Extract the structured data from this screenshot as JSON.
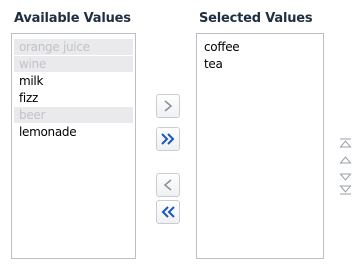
{
  "headers": {
    "available": "Available Values",
    "selected": "Selected Values"
  },
  "available_items": [
    {
      "label": "orange juice",
      "state": "disabled"
    },
    {
      "label": "wine",
      "state": "disabled"
    },
    {
      "label": "milk",
      "state": "enabled"
    },
    {
      "label": "fizz",
      "state": "enabled"
    },
    {
      "label": "beer",
      "state": "disabled"
    },
    {
      "label": "lemonade",
      "state": "enabled"
    }
  ],
  "selected_items": [
    {
      "label": "coffee"
    },
    {
      "label": "tea"
    }
  ],
  "shuttle_buttons": [
    {
      "name": "move-right-button",
      "icon": "chevron-right-icon",
      "enabled": false
    },
    {
      "name": "move-all-right-button",
      "icon": "double-chevron-right-icon",
      "enabled": true
    },
    {
      "name": "move-left-button",
      "icon": "chevron-left-icon",
      "enabled": false
    },
    {
      "name": "move-all-left-button",
      "icon": "double-chevron-left-icon",
      "enabled": true
    }
  ],
  "order_buttons": [
    {
      "name": "move-top-button",
      "icon": "move-top-icon"
    },
    {
      "name": "move-up-button",
      "icon": "move-up-icon"
    },
    {
      "name": "move-down-button",
      "icon": "move-down-icon"
    },
    {
      "name": "move-bottom-button",
      "icon": "move-bottom-icon"
    }
  ],
  "colors": {
    "header_text": "#1f2f3f",
    "disabled_item_bg": "#eaeaed",
    "disabled_item_text": "#c0c3c8",
    "enabled_arrow": "#1a56c4",
    "disabled_arrow": "#8e9197",
    "order_arrow": "#9aa0a8",
    "list_border": "#b9c0c8"
  }
}
